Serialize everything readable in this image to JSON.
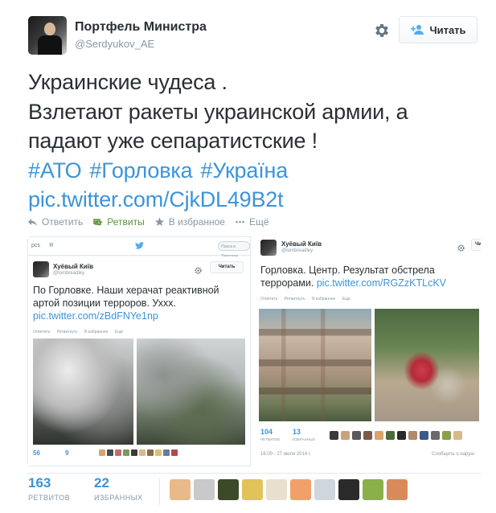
{
  "header": {
    "display_name": "Портфель Министра",
    "handle": "@Serdyukov_AE",
    "follow_label": "Читать"
  },
  "tweet": {
    "lines": [
      "Украинские чудеса .",
      "Взлетают ракеты украинской армии, а",
      "падают уже сепаратистские !"
    ],
    "hashtags": [
      "#АТО",
      "#Горловка",
      "#Україна"
    ],
    "media_link": "pic.twitter.com/CjkDL49B2t"
  },
  "actions": {
    "reply": "Ответить",
    "retweet": "Ретвиты",
    "favorite": "В избранное",
    "more": "Ещё"
  },
  "media": {
    "left_screenshot": {
      "topbar_a": "pcs",
      "topbar_b": "Я",
      "search_placeholder": "Поиск в Твиттере",
      "display_name": "Хуёвый Київ",
      "handle": "@tombreadley",
      "follow_label": "Читать",
      "text_lines": [
        "По Горловке. Наши херачат реактивной",
        "артой позиции терроров. Уххх."
      ],
      "link": "pic.twitter.com/zBdFNYe1np",
      "actions": [
        "Ответить",
        "Ретвитнуть",
        "В избранное",
        "Ещё"
      ],
      "retweets": "56",
      "favorites": "9",
      "face_colors": [
        "#d9a36b",
        "#4a4a4a",
        "#c76a6a",
        "#7a9a5a",
        "#3a3a3a",
        "#d9b88a",
        "#8a6a4a",
        "#e0c070",
        "#6a7a9a",
        "#b04a4a"
      ]
    },
    "right_screenshot": {
      "display_name": "Хуёвый Київ",
      "handle": "@tombreadley",
      "follow_label": "Читать",
      "text_lines": [
        "Горловка. Центр. Результат обстрела"
      ],
      "text_prefix": "террорами.",
      "link": "pic.twitter.com/RGZzKTLcKV",
      "actions": [
        "Ответить",
        "Ретвитнуть",
        "В избранное",
        "Ещё"
      ],
      "retweets": "104",
      "retweets_label": "РЕТВИТОВ",
      "favorites": "13",
      "favorites_label": "ИЗБРАННЫХ",
      "date": "16:00 - 27 июля 2014 г.",
      "report": "Сообщить о наруш",
      "face_colors": [
        "#3a3a3a",
        "#c9a27a",
        "#5a5a5a",
        "#7a5a4a",
        "#d9a36b",
        "#4a6a3a",
        "#2a2a2a",
        "#b08a6a",
        "#3a5a8a",
        "#6a6a6a",
        "#8aa04a",
        "#d9b88a"
      ]
    }
  },
  "stats": {
    "retweets": "163",
    "retweets_label": "РЕТВИТОВ",
    "favorites": "22",
    "favorites_label": "ИЗБРАННЫХ"
  },
  "favoriters": {
    "colors": [
      "#e9b98a",
      "#c9c9c9",
      "#3d4a2a",
      "#e2c25a",
      "#e9dfcf",
      "#f1a06a",
      "#cfd6dc",
      "#2a2a2a",
      "#8ab04a",
      "#d98a5a"
    ]
  },
  "colors": {
    "link": "#3b94d9",
    "retweet_green": "#5c913b",
    "muted": "#8899a6"
  }
}
